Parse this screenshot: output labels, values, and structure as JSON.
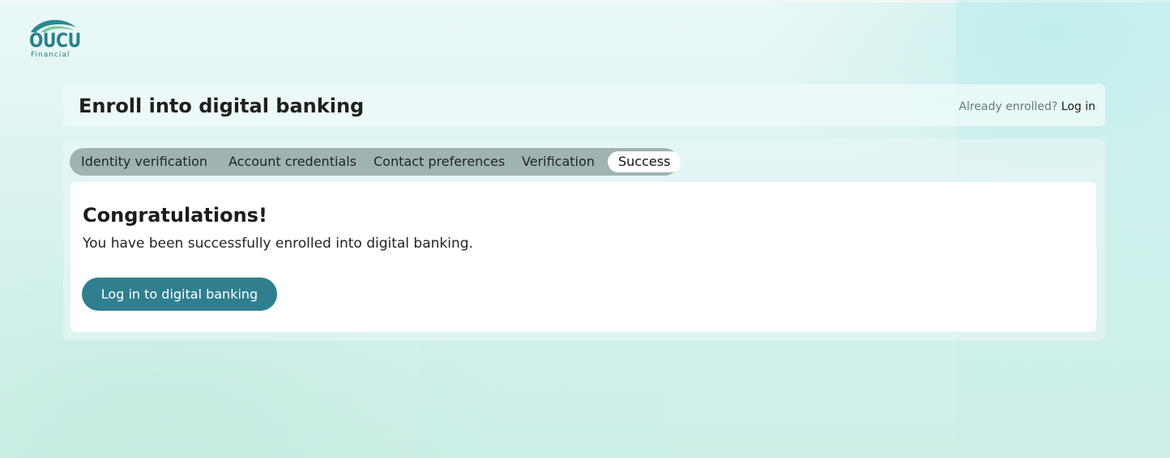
{
  "brand": {
    "logo_word": "OUCU",
    "logo_sub": "Financial",
    "primary_color": "#2f7f8e"
  },
  "header": {
    "title": "Enroll into digital banking",
    "already_enrolled_text": "Already enrolled?",
    "login_link": "Log in"
  },
  "stepper": {
    "steps": [
      {
        "label": "Identity verification",
        "active": false
      },
      {
        "label": "Account credentials",
        "active": false
      },
      {
        "label": "Contact preferences",
        "active": false
      },
      {
        "label": "Verification",
        "active": false
      },
      {
        "label": "Success",
        "active": true
      }
    ]
  },
  "content": {
    "heading": "Congratulations!",
    "message": "You have been successfully enrolled into digital banking.",
    "button_label": "Log in to digital banking"
  }
}
